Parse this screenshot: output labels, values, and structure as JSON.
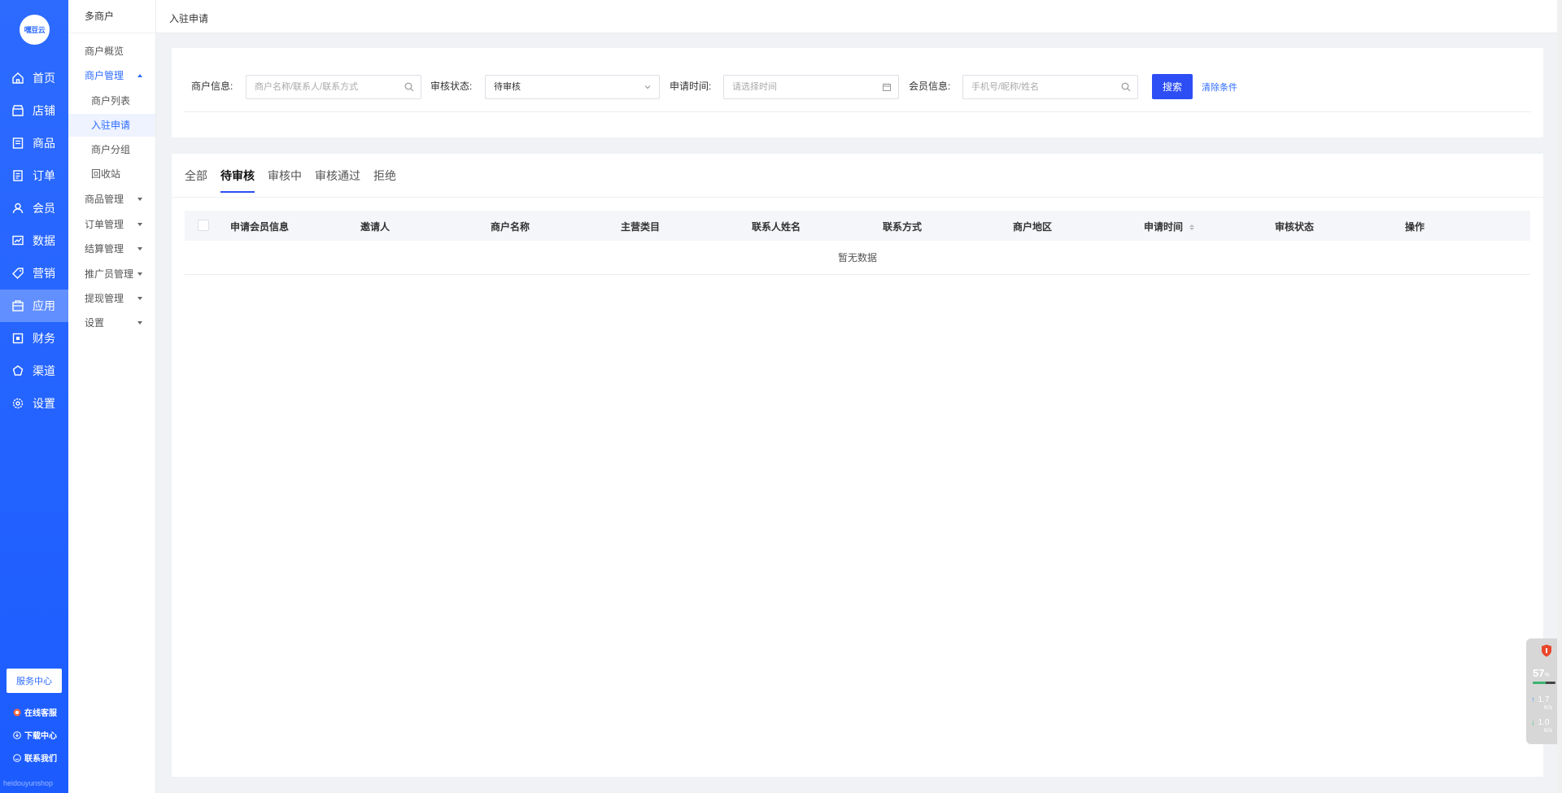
{
  "sidebar": {
    "logo_text": "嘿豆云",
    "items": [
      {
        "label": "首页",
        "icon": "home-icon"
      },
      {
        "label": "店铺",
        "icon": "store-icon"
      },
      {
        "label": "商品",
        "icon": "goods-icon"
      },
      {
        "label": "订单",
        "icon": "order-icon"
      },
      {
        "label": "会员",
        "icon": "user-icon"
      },
      {
        "label": "数据",
        "icon": "chart-icon"
      },
      {
        "label": "营销",
        "icon": "tag-icon"
      },
      {
        "label": "应用",
        "icon": "app-icon"
      },
      {
        "label": "财务",
        "icon": "finance-icon"
      },
      {
        "label": "渠道",
        "icon": "channel-icon"
      },
      {
        "label": "设置",
        "icon": "gear-icon"
      }
    ],
    "active_item": "应用",
    "service_center": "服务中心",
    "online_service": "在线客服",
    "download_center": "下载中心",
    "contact_us": "联系我们",
    "footer_text": "heidouyunshop"
  },
  "subsidebar": {
    "title": "多商户",
    "items": [
      {
        "label": "商户概览"
      },
      {
        "label": "商户管理"
      },
      {
        "label": "商户列表"
      },
      {
        "label": "入驻申请"
      },
      {
        "label": "商户分组"
      },
      {
        "label": "回收站"
      },
      {
        "label": "商品管理"
      },
      {
        "label": "订单管理"
      },
      {
        "label": "结算管理"
      },
      {
        "label": "推广员管理"
      },
      {
        "label": "提现管理"
      },
      {
        "label": "设置"
      }
    ]
  },
  "header": {
    "breadcrumb": "入驻申请"
  },
  "filter": {
    "merchant_label": "商户信息:",
    "merchant_placeholder": "商户名称/联系人/联系方式",
    "status_label": "审核状态:",
    "status_value": "待审核",
    "time_label": "申请时间:",
    "time_placeholder": "请选择时间",
    "member_label": "会员信息:",
    "member_placeholder": "手机号/昵称/姓名",
    "search_button": "搜索",
    "clear_link": "清除条件"
  },
  "tabs": [
    {
      "label": "全部"
    },
    {
      "label": "待审核"
    },
    {
      "label": "审核中"
    },
    {
      "label": "审核通过"
    },
    {
      "label": "拒绝"
    }
  ],
  "active_tab": "待审核",
  "table": {
    "columns": [
      "申请会员信息",
      "邀请人",
      "商户名称",
      "主营类目",
      "联系人姓名",
      "联系方式",
      "商户地区",
      "申请时间",
      "审核状态",
      "操作"
    ],
    "empty_text": "暂无数据"
  },
  "widget": {
    "percent": "57",
    "percent_unit": "%",
    "upload": "1.7",
    "download": "1.0",
    "speed_unit": "K/s",
    "bar_fraction": 0.57
  },
  "colors": {
    "brand": "#2d6bff",
    "primary_button": "#2d4ef5"
  }
}
